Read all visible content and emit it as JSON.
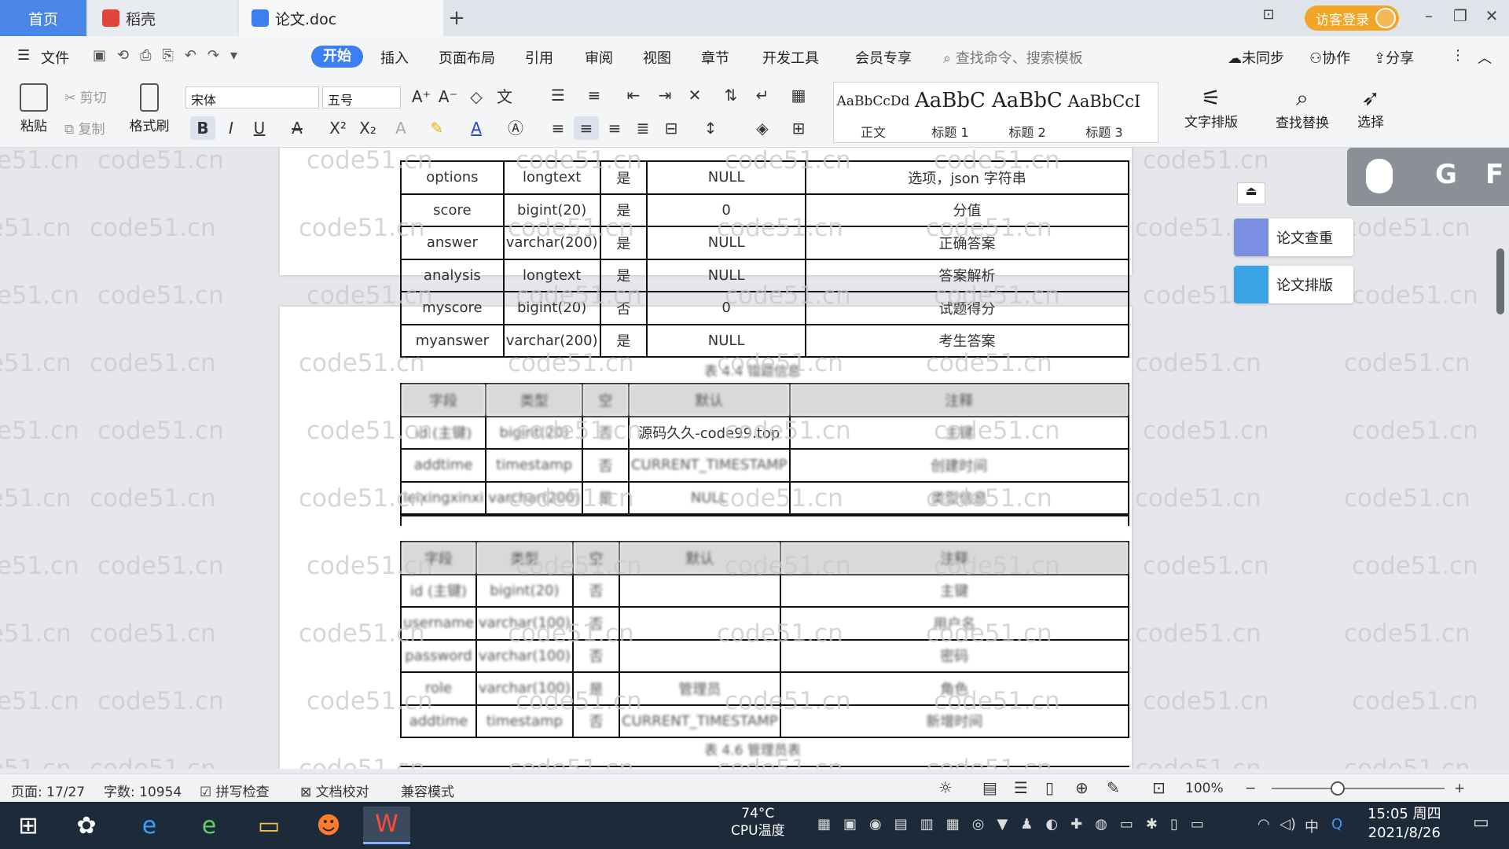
{
  "titlebar": {
    "tabs": [
      {
        "label": "首页"
      },
      {
        "label": "稻壳"
      },
      {
        "label": "论文.doc"
      }
    ],
    "login_label": "访客登录"
  },
  "menu": {
    "file": "文件",
    "items": [
      "开始",
      "插入",
      "页面布局",
      "引用",
      "审阅",
      "视图",
      "章节",
      "开发工具",
      "会员专享"
    ],
    "search_placeholder": "查找命令、搜索模板",
    "sync": "未同步",
    "collab": "协作",
    "share": "分享"
  },
  "ribbon": {
    "paste": "粘贴",
    "cut": "剪切",
    "copy": "复制",
    "format_painter": "格式刷",
    "font_name": "宋体",
    "font_size": "五号",
    "styles": [
      {
        "sample": "AaBbCcDd",
        "label": "正文"
      },
      {
        "sample": "AaBbC",
        "label": "标题 1"
      },
      {
        "sample": "AaBbC",
        "label": "标题 2"
      },
      {
        "sample": "AaBbCcI",
        "label": "标题 3"
      }
    ],
    "text_layout": "文字排版",
    "find_replace": "查找替换",
    "select": "选择"
  },
  "doc": {
    "table1_rows": [
      [
        "options",
        "longtext",
        "是",
        "NULL",
        "选项，json 字符串"
      ],
      [
        "score",
        "bigint(20)",
        "是",
        "0",
        "分值"
      ],
      [
        "answer",
        "varchar(200)",
        "是",
        "NULL",
        "正确答案"
      ],
      [
        "analysis",
        "longtext",
        "是",
        "NULL",
        "答案解析"
      ],
      [
        "myscore",
        "bigint(20)",
        "否",
        "0",
        "试题得分"
      ],
      [
        "myanswer",
        "varchar(200)",
        "是",
        "NULL",
        "考生答案"
      ]
    ],
    "caption1": "表 4.4 错题信息",
    "table2_rows": [
      [
        "字段",
        "类型",
        "空",
        "默认",
        "注释"
      ],
      [
        "id (主键)",
        "bigint(20)",
        "否",
        "源码久久-code99.top",
        "主键"
      ],
      [
        "addtime",
        "timestamp",
        "否",
        "CURRENT_TIMESTAMP",
        "创建时间"
      ],
      [
        "leixingxinxi",
        "varchar(200)",
        "是",
        "NULL",
        "类型信息"
      ]
    ],
    "table3_rows": [
      [
        "字段",
        "类型",
        "空",
        "默认",
        "注释"
      ],
      [
        "id (主键)",
        "bigint(20)",
        "否",
        "",
        "主键"
      ],
      [
        "username",
        "varchar(100)",
        "否",
        "",
        "用户名"
      ],
      [
        "password",
        "varchar(100)",
        "否",
        "",
        "密码"
      ],
      [
        "role",
        "varchar(100)",
        "是",
        "管理员",
        "角色"
      ],
      [
        "addtime",
        "timestamp",
        "否",
        "CURRENT_TIMESTAMP",
        "新增时间"
      ]
    ],
    "caption3": "表 4.6 管理员表",
    "watermark": "code51.cn"
  },
  "side_panel": {
    "check": "论文查重",
    "layout": "论文排版",
    "ime": [
      "G",
      "F"
    ]
  },
  "statusbar": {
    "page": "页面: 17/27",
    "words": "字数: 10954",
    "spell": "拼写检查",
    "proof": "文档校对",
    "compat": "兼容模式",
    "zoom": "100%",
    "zoom_level": 0.38
  },
  "taskbar": {
    "temp": "74°C",
    "cpu": "CPU温度",
    "ime": "中",
    "time": "15:05 周四",
    "date": "2021/8/26"
  },
  "colors": {
    "accent": "#3b7ff2",
    "login": "#f2a527",
    "taskbar": "#1c2a3a"
  }
}
